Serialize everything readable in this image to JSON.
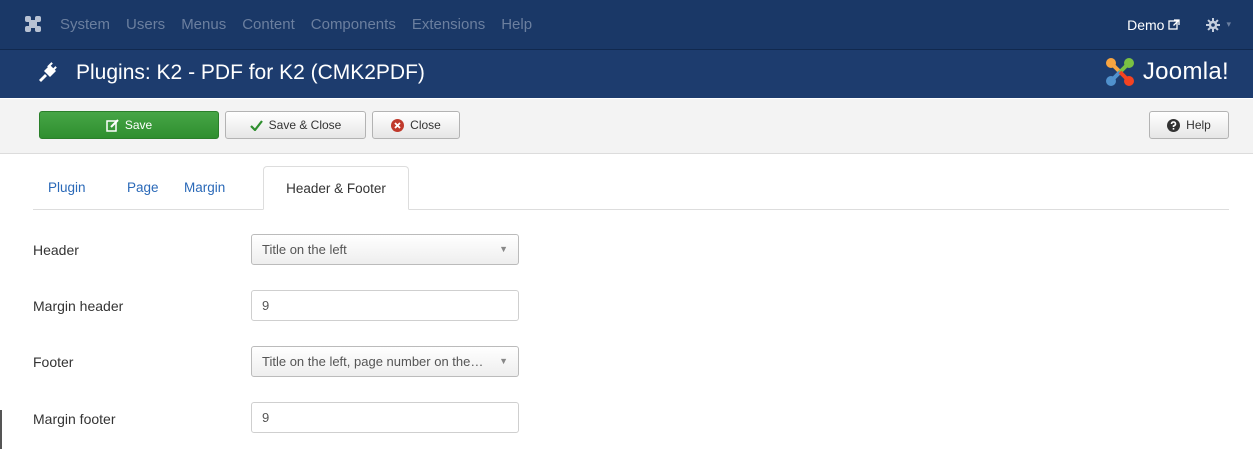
{
  "navbar": {
    "menu": [
      "System",
      "Users",
      "Menus",
      "Content",
      "Components",
      "Extensions",
      "Help"
    ],
    "site_link": "Demo",
    "settings_caret": "▾"
  },
  "header": {
    "title": "Plugins: K2 - PDF for K2 (CMK2PDF)",
    "brand": "Joomla!"
  },
  "toolbar": {
    "save_label": "Save",
    "save_close_label": "Save & Close",
    "close_label": "Close",
    "help_label": "Help"
  },
  "tabs": [
    {
      "label": "Plugin",
      "active": false
    },
    {
      "label": "Page",
      "active": false
    },
    {
      "label": "Margin",
      "active": false
    },
    {
      "label": "Header & Footer",
      "active": true
    }
  ],
  "form": {
    "header": {
      "label": "Header",
      "value": "Title on the left"
    },
    "margin_header": {
      "label": "Margin header",
      "value": "9"
    },
    "footer": {
      "label": "Footer",
      "value": "Title on the left, page number on the right"
    },
    "margin_footer": {
      "label": "Margin footer",
      "value": "9"
    }
  },
  "colors": {
    "navbar": "#1a3867",
    "header": "#1d3c6e",
    "save_button": "#3d9c3d",
    "link": "#2a69b8"
  }
}
